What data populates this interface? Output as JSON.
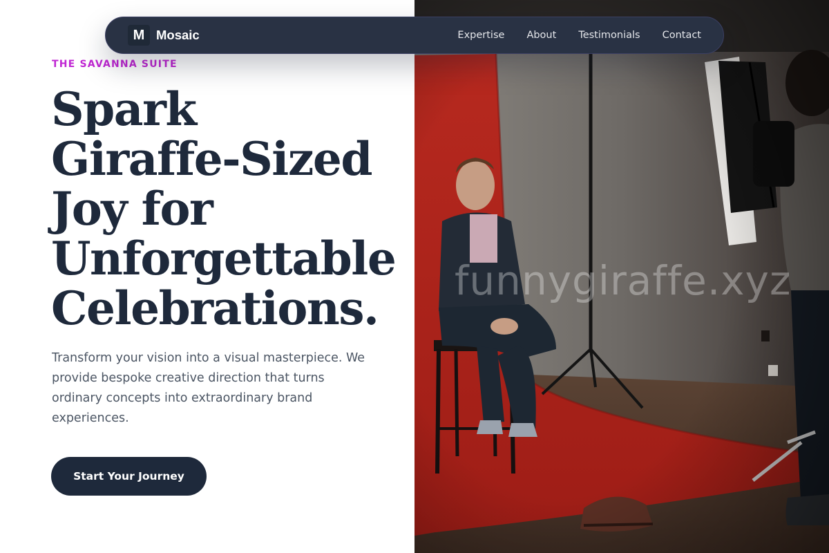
{
  "nav": {
    "brand_mark": "M",
    "brand_name": "Mosaic",
    "links": [
      "Expertise",
      "About",
      "Testimonials",
      "Contact"
    ]
  },
  "hero": {
    "eyebrow": "THE SAVANNA SUITE",
    "headline_lines": [
      "Spark",
      "Giraffe-Sized",
      "Joy for",
      "Unforgettable",
      "Celebrations."
    ],
    "description": "Transform your vision into a visual masterpiece. We provide bespoke creative direction that turns ordinary concepts into extraordinary brand experiences.",
    "cta_label": "Start Your Journey"
  },
  "photo": {
    "watermark": "funnygiraffe.xyz"
  },
  "colors": {
    "accent": "#c026d3",
    "primary": "#1e293b",
    "nav_background": "#293244",
    "backdrop_red": "#b7291f"
  }
}
